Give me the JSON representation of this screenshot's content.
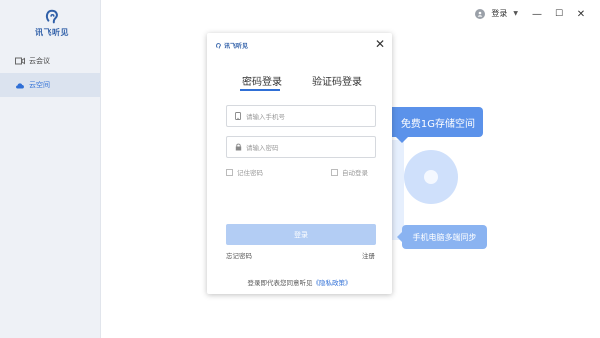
{
  "app": {
    "logo_text": "讯飞听见"
  },
  "sidebar": {
    "items": [
      {
        "label": "云会议",
        "icon": "video-icon"
      },
      {
        "label": "云空间",
        "icon": "cloud-icon"
      }
    ]
  },
  "topbar": {
    "login_label": "登录",
    "caret": "▼",
    "minimize": "—",
    "maximize": "☐",
    "close": "✕"
  },
  "illustration": {
    "bubble_top": "免费1G存储空间",
    "bubble_bottom": "手机电脑多端同步"
  },
  "modal": {
    "logo_text": "讯飞听见",
    "close": "✕",
    "tabs": [
      {
        "label": "密码登录",
        "active": true
      },
      {
        "label": "验证码登录",
        "active": false
      }
    ],
    "phone_placeholder": "请输入手机号",
    "password_placeholder": "请输入密码",
    "remember_label": "记住密码",
    "auto_login_label": "自动登录",
    "login_button": "登录",
    "forgot_link": "忘记密码",
    "register_link": "注册",
    "agreement_prefix": "登录即代表您同意听见",
    "privacy_link": "《隐私政策》"
  },
  "colors": {
    "accent": "#2f6fd6",
    "button_disabled": "#b3cdf4",
    "sidebar_bg": "#eef1f6"
  }
}
